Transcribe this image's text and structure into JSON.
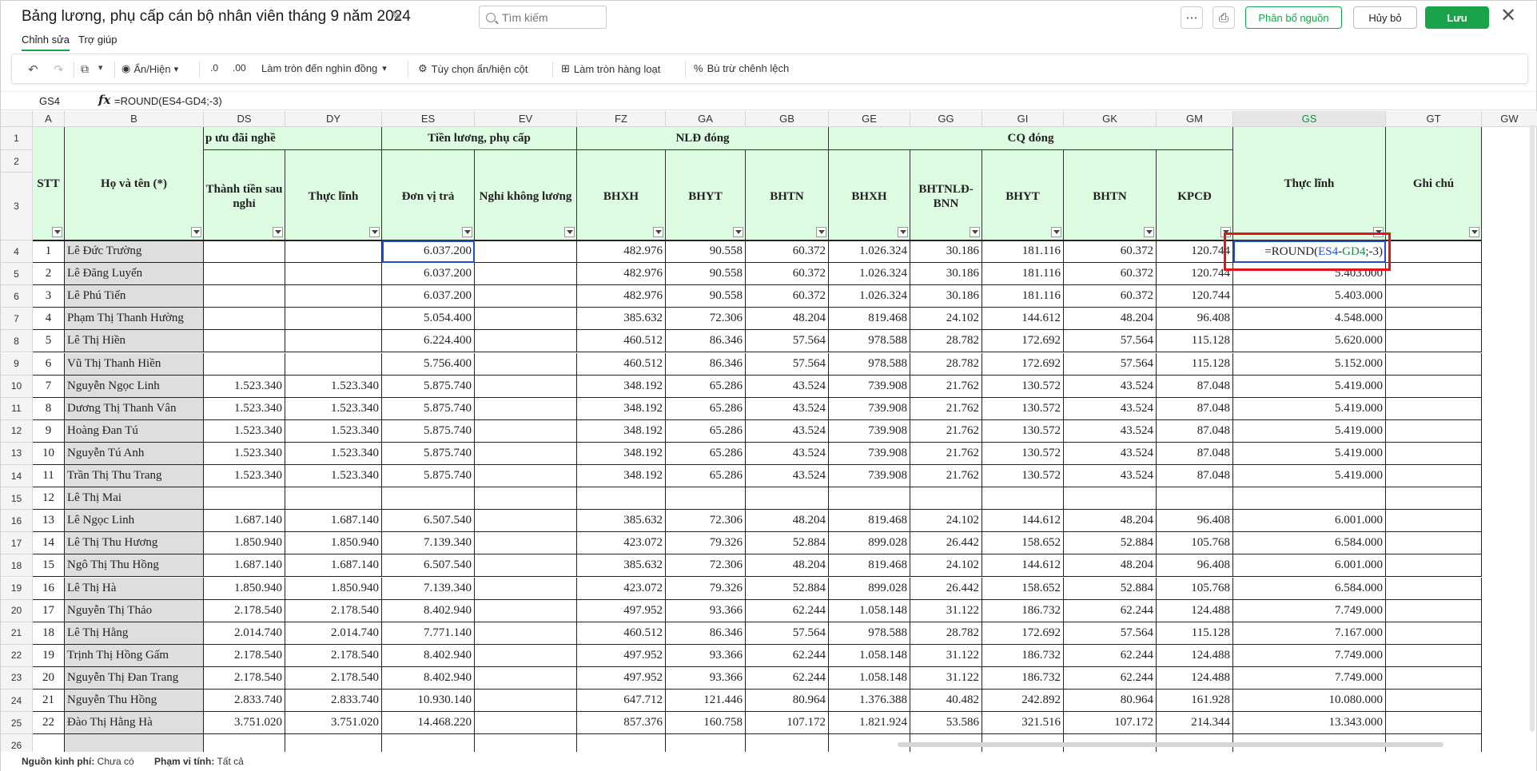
{
  "header": {
    "title": "Bảng lương, phụ cấp cán bộ nhân viên tháng 9 năm 2024",
    "search_placeholder": "Tìm kiếm",
    "allocate_label": "Phân bổ nguồn",
    "cancel_label": "Hủy bỏ",
    "save_label": "Lưu"
  },
  "tabs": [
    "Chỉnh sửa",
    "Trợ giúp"
  ],
  "toolbar": {
    "show_hide": "Ẩn/Hiện",
    "dec_less": ".0",
    "dec_more": ".00",
    "rounding": "Làm tròn đến nghìn đồng",
    "col_options": "Tùy chọn ẩn/hiện cột",
    "batch_round": "Làm tròn hàng loạt",
    "diff_offset": "Bù trừ chênh lệch"
  },
  "formula_bar": {
    "cell_ref": "GS4",
    "formula": "=ROUND(ES4-GD4;-3)"
  },
  "active_cell_formula": {
    "prefix": "=ROUND(",
    "ref1": "ES4",
    "minus": "-",
    "ref2": "GD4",
    "suffix": ";-3)"
  },
  "colors": {
    "green": "#1aa34a",
    "header_fill": "#ddfbe1",
    "ref_blue": "#1f4fd8",
    "ref_green": "#1a8a3a",
    "highlight_red": "#e0161b"
  },
  "columns": [
    "A",
    "B",
    "DS",
    "DY",
    "ES",
    "EV",
    "FZ",
    "GA",
    "GB",
    "GE",
    "GG",
    "GI",
    "GK",
    "GM",
    "GS",
    "GT",
    "GW"
  ],
  "group_headers": {
    "stt": "STT",
    "name": "Họ và tên (*)",
    "allowance": "p ưu đãi nghề",
    "salary": "Tiền lương, phụ cấp",
    "nld": "NLĐ đóng",
    "cq": "CQ đóng",
    "net": "Thực lĩnh",
    "note": "Ghi chú"
  },
  "sub_headers": [
    "Thành tiền sau nghỉ",
    "Thực lĩnh",
    "Đơn vị trả",
    "Nghỉ không lương",
    "BHXH",
    "BHYT",
    "BHTN",
    "BHXH",
    "BHTNLĐ-BNN",
    "BHYT",
    "BHTN",
    "KPCĐ"
  ],
  "header_row_numbers": [
    "1",
    "2",
    "3"
  ],
  "rows": [
    {
      "r": "4",
      "stt": "1",
      "name": "Lê Đức Trường",
      "ds": "",
      "dy": "",
      "es": "6.037.200",
      "ev": "",
      "fz": "482.976",
      "ga": "90.558",
      "gb": "60.372",
      "ge": "1.026.324",
      "gg": "30.186",
      "gi": "181.116",
      "gk": "60.372",
      "gm": "120.744",
      "gs": ""
    },
    {
      "r": "5",
      "stt": "2",
      "name": "Lê Đăng Luyến",
      "ds": "",
      "dy": "",
      "es": "6.037.200",
      "ev": "",
      "fz": "482.976",
      "ga": "90.558",
      "gb": "60.372",
      "ge": "1.026.324",
      "gg": "30.186",
      "gi": "181.116",
      "gk": "60.372",
      "gm": "120.744",
      "gs": "5.403.000"
    },
    {
      "r": "6",
      "stt": "3",
      "name": "Lê Phú Tiến",
      "ds": "",
      "dy": "",
      "es": "6.037.200",
      "ev": "",
      "fz": "482.976",
      "ga": "90.558",
      "gb": "60.372",
      "ge": "1.026.324",
      "gg": "30.186",
      "gi": "181.116",
      "gk": "60.372",
      "gm": "120.744",
      "gs": "5.403.000"
    },
    {
      "r": "7",
      "stt": "4",
      "name": "Phạm Thị Thanh  Hường",
      "ds": "",
      "dy": "",
      "es": "5.054.400",
      "ev": "",
      "fz": "385.632",
      "ga": "72.306",
      "gb": "48.204",
      "ge": "819.468",
      "gg": "24.102",
      "gi": "144.612",
      "gk": "48.204",
      "gm": "96.408",
      "gs": "4.548.000"
    },
    {
      "r": "8",
      "stt": "5",
      "name": "Lê Thị Hiền",
      "ds": "",
      "dy": "",
      "es": "6.224.400",
      "ev": "",
      "fz": "460.512",
      "ga": "86.346",
      "gb": "57.564",
      "ge": "978.588",
      "gg": "28.782",
      "gi": "172.692",
      "gk": "57.564",
      "gm": "115.128",
      "gs": "5.620.000"
    },
    {
      "r": "9",
      "stt": "6",
      "name": "Vũ Thị Thanh Hiền",
      "ds": "",
      "dy": "",
      "es": "5.756.400",
      "ev": "",
      "fz": "460.512",
      "ga": "86.346",
      "gb": "57.564",
      "ge": "978.588",
      "gg": "28.782",
      "gi": "172.692",
      "gk": "57.564",
      "gm": "115.128",
      "gs": "5.152.000"
    },
    {
      "r": "10",
      "stt": "7",
      "name": "Nguyễn Ngọc Linh",
      "ds": "1.523.340",
      "dy": "1.523.340",
      "es": "5.875.740",
      "ev": "",
      "fz": "348.192",
      "ga": "65.286",
      "gb": "43.524",
      "ge": "739.908",
      "gg": "21.762",
      "gi": "130.572",
      "gk": "43.524",
      "gm": "87.048",
      "gs": "5.419.000"
    },
    {
      "r": "11",
      "stt": "8",
      "name": "Dương Thị Thanh Vân",
      "ds": "1.523.340",
      "dy": "1.523.340",
      "es": "5.875.740",
      "ev": "",
      "fz": "348.192",
      "ga": "65.286",
      "gb": "43.524",
      "ge": "739.908",
      "gg": "21.762",
      "gi": "130.572",
      "gk": "43.524",
      "gm": "87.048",
      "gs": "5.419.000"
    },
    {
      "r": "12",
      "stt": "9",
      "name": "Hoàng Đan Tú",
      "ds": "1.523.340",
      "dy": "1.523.340",
      "es": "5.875.740",
      "ev": "",
      "fz": "348.192",
      "ga": "65.286",
      "gb": "43.524",
      "ge": "739.908",
      "gg": "21.762",
      "gi": "130.572",
      "gk": "43.524",
      "gm": "87.048",
      "gs": "5.419.000"
    },
    {
      "r": "13",
      "stt": "10",
      "name": "Nguyễn Tú Anh",
      "ds": "1.523.340",
      "dy": "1.523.340",
      "es": "5.875.740",
      "ev": "",
      "fz": "348.192",
      "ga": "65.286",
      "gb": "43.524",
      "ge": "739.908",
      "gg": "21.762",
      "gi": "130.572",
      "gk": "43.524",
      "gm": "87.048",
      "gs": "5.419.000"
    },
    {
      "r": "14",
      "stt": "11",
      "name": "Trần Thị Thu Trang",
      "ds": "1.523.340",
      "dy": "1.523.340",
      "es": "5.875.740",
      "ev": "",
      "fz": "348.192",
      "ga": "65.286",
      "gb": "43.524",
      "ge": "739.908",
      "gg": "21.762",
      "gi": "130.572",
      "gk": "43.524",
      "gm": "87.048",
      "gs": "5.419.000"
    },
    {
      "r": "15",
      "stt": "12",
      "name": "Lê Thị Mai",
      "ds": "",
      "dy": "",
      "es": "",
      "ev": "",
      "fz": "",
      "ga": "",
      "gb": "",
      "ge": "",
      "gg": "",
      "gi": "",
      "gk": "",
      "gm": "",
      "gs": ""
    },
    {
      "r": "16",
      "stt": "13",
      "name": "Lê Ngọc Linh",
      "ds": "1.687.140",
      "dy": "1.687.140",
      "es": "6.507.540",
      "ev": "",
      "fz": "385.632",
      "ga": "72.306",
      "gb": "48.204",
      "ge": "819.468",
      "gg": "24.102",
      "gi": "144.612",
      "gk": "48.204",
      "gm": "96.408",
      "gs": "6.001.000"
    },
    {
      "r": "17",
      "stt": "14",
      "name": "Lê Thị Thu Hương",
      "ds": "1.850.940",
      "dy": "1.850.940",
      "es": "7.139.340",
      "ev": "",
      "fz": "423.072",
      "ga": "79.326",
      "gb": "52.884",
      "ge": "899.028",
      "gg": "26.442",
      "gi": "158.652",
      "gk": "52.884",
      "gm": "105.768",
      "gs": "6.584.000"
    },
    {
      "r": "18",
      "stt": "15",
      "name": "Ngô Thị Thu Hồng",
      "ds": "1.687.140",
      "dy": "1.687.140",
      "es": "6.507.540",
      "ev": "",
      "fz": "385.632",
      "ga": "72.306",
      "gb": "48.204",
      "ge": "819.468",
      "gg": "24.102",
      "gi": "144.612",
      "gk": "48.204",
      "gm": "96.408",
      "gs": "6.001.000"
    },
    {
      "r": "19",
      "stt": "16",
      "name": "Lê Thị Hà",
      "ds": "1.850.940",
      "dy": "1.850.940",
      "es": "7.139.340",
      "ev": "",
      "fz": "423.072",
      "ga": "79.326",
      "gb": "52.884",
      "ge": "899.028",
      "gg": "26.442",
      "gi": "158.652",
      "gk": "52.884",
      "gm": "105.768",
      "gs": "6.584.000"
    },
    {
      "r": "20",
      "stt": "17",
      "name": "Nguyễn Thị Thảo",
      "ds": "2.178.540",
      "dy": "2.178.540",
      "es": "8.402.940",
      "ev": "",
      "fz": "497.952",
      "ga": "93.366",
      "gb": "62.244",
      "ge": "1.058.148",
      "gg": "31.122",
      "gi": "186.732",
      "gk": "62.244",
      "gm": "124.488",
      "gs": "7.749.000"
    },
    {
      "r": "21",
      "stt": "18",
      "name": "Lê Thị Hằng",
      "ds": "2.014.740",
      "dy": "2.014.740",
      "es": "7.771.140",
      "ev": "",
      "fz": "460.512",
      "ga": "86.346",
      "gb": "57.564",
      "ge": "978.588",
      "gg": "28.782",
      "gi": "172.692",
      "gk": "57.564",
      "gm": "115.128",
      "gs": "7.167.000"
    },
    {
      "r": "22",
      "stt": "19",
      "name": "Trịnh Thị Hồng Gấm",
      "ds": "2.178.540",
      "dy": "2.178.540",
      "es": "8.402.940",
      "ev": "",
      "fz": "497.952",
      "ga": "93.366",
      "gb": "62.244",
      "ge": "1.058.148",
      "gg": "31.122",
      "gi": "186.732",
      "gk": "62.244",
      "gm": "124.488",
      "gs": "7.749.000"
    },
    {
      "r": "23",
      "stt": "20",
      "name": "Nguyễn Thị  Đan Trang",
      "ds": "2.178.540",
      "dy": "2.178.540",
      "es": "8.402.940",
      "ev": "",
      "fz": "497.952",
      "ga": "93.366",
      "gb": "62.244",
      "ge": "1.058.148",
      "gg": "31.122",
      "gi": "186.732",
      "gk": "62.244",
      "gm": "124.488",
      "gs": "7.749.000"
    },
    {
      "r": "24",
      "stt": "21",
      "name": "Nguyễn Thu Hồng",
      "ds": "2.833.740",
      "dy": "2.833.740",
      "es": "10.930.140",
      "ev": "",
      "fz": "647.712",
      "ga": "121.446",
      "gb": "80.964",
      "ge": "1.376.388",
      "gg": "40.482",
      "gi": "242.892",
      "gk": "80.964",
      "gm": "161.928",
      "gs": "10.080.000"
    },
    {
      "r": "25",
      "stt": "22",
      "name": "Đào Thị Hằng Hà",
      "ds": "3.751.020",
      "dy": "3.751.020",
      "es": "14.468.220",
      "ev": "",
      "fz": "857.376",
      "ga": "160.758",
      "gb": "107.172",
      "ge": "1.821.924",
      "gg": "53.586",
      "gi": "321.516",
      "gk": "107.172",
      "gm": "214.344",
      "gs": "13.343.000"
    },
    {
      "r": "26",
      "stt": "",
      "name": "",
      "ds": "",
      "dy": "",
      "es": "",
      "ev": "",
      "fz": "",
      "ga": "",
      "gb": "",
      "ge": "",
      "gg": "",
      "gi": "",
      "gk": "",
      "gm": "",
      "gs": ""
    }
  ],
  "footer": {
    "fund_label": "Nguồn kinh phí:",
    "fund_value": "Chưa có",
    "scope_label": "Phạm vi tính:",
    "scope_value": "Tất cả"
  }
}
